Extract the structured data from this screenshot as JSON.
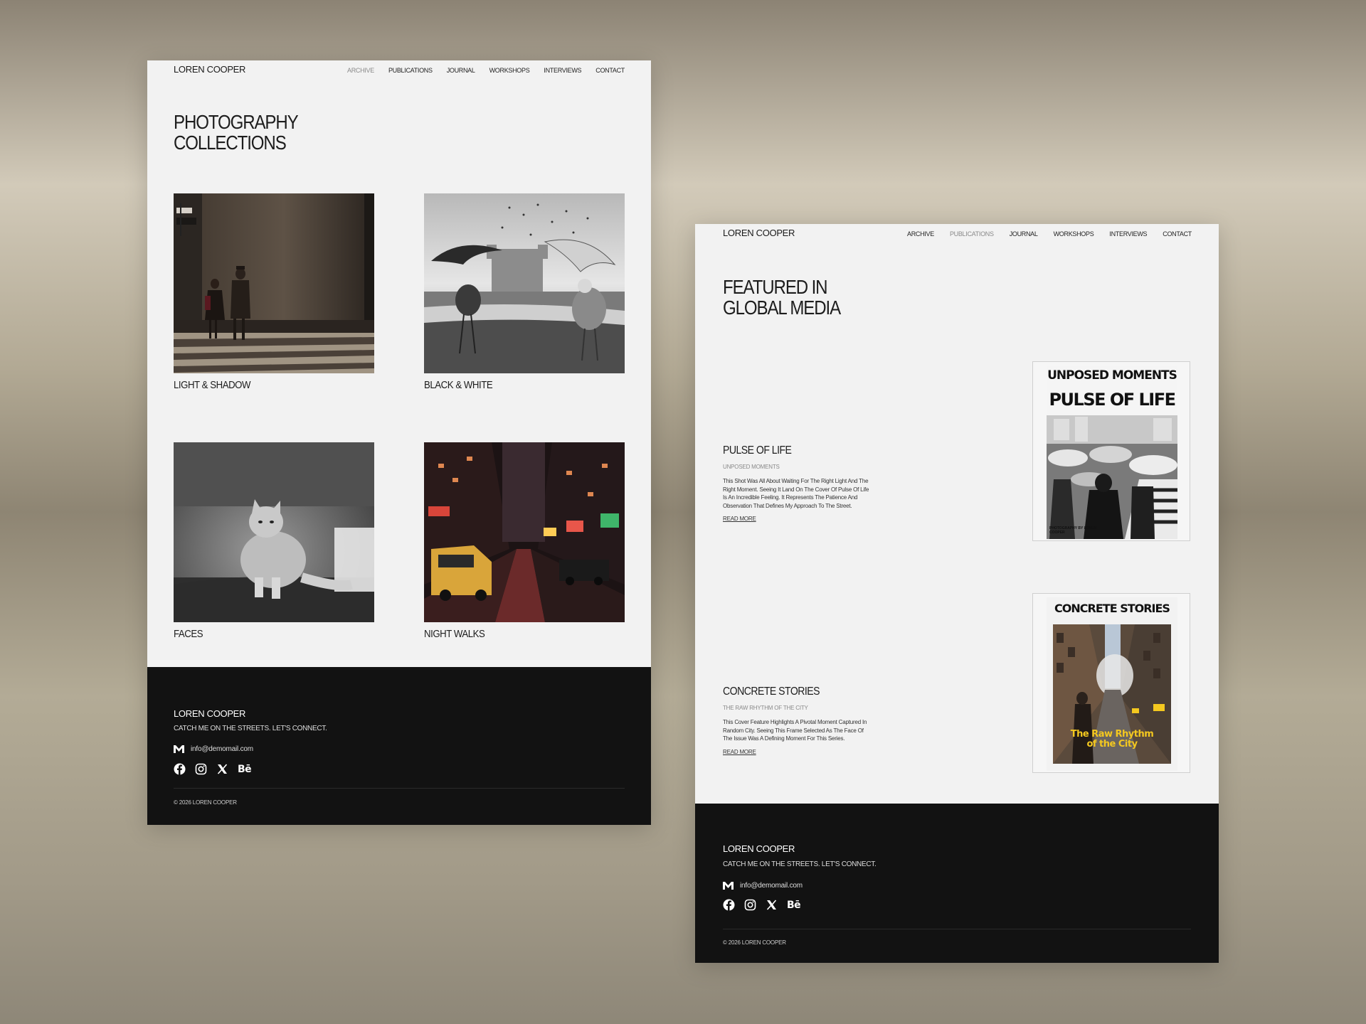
{
  "archive_page": {
    "logo": "LOREN COOPER",
    "nav": [
      {
        "label": "ARCHIVE",
        "active": true
      },
      {
        "label": "PUBLICATIONS",
        "active": false
      },
      {
        "label": "JOURNAL",
        "active": false
      },
      {
        "label": "WORKSHOPS",
        "active": false
      },
      {
        "label": "INTERVIEWS",
        "active": false
      },
      {
        "label": "CONTACT",
        "active": false
      }
    ],
    "heading_line1": "PHOTOGRAPHY",
    "heading_line2": "COLLECTIONS",
    "collections": [
      {
        "label": "LIGHT & SHADOW"
      },
      {
        "label": "BLACK & WHITE"
      },
      {
        "label": "FACES"
      },
      {
        "label": "NIGHT WALKS"
      }
    ],
    "footer": {
      "logo": "LOREN COOPER",
      "tagline": "CATCH ME ON THE STREETS. LET'S CONNECT.",
      "email": "info@demomail.com",
      "social_icons": [
        "facebook-icon",
        "instagram-icon",
        "x-icon",
        "behance-icon"
      ],
      "behance_label": "Bē",
      "copyright": "© 2026 LOREN COOPER"
    }
  },
  "publications_page": {
    "logo": "LOREN COOPER",
    "nav": [
      {
        "label": "ARCHIVE",
        "active": false
      },
      {
        "label": "PUBLICATIONS",
        "active": true
      },
      {
        "label": "JOURNAL",
        "active": false
      },
      {
        "label": "WORKSHOPS",
        "active": false
      },
      {
        "label": "INTERVIEWS",
        "active": false
      },
      {
        "label": "CONTACT",
        "active": false
      }
    ],
    "heading_line1": "FEATURED IN",
    "heading_line2": "GLOBAL MEDIA",
    "features": [
      {
        "title": "PULSE OF LIFE",
        "subtitle": "UNPOSED MOMENTS",
        "description": "This Shot Was All About Waiting For The Right Light And The Right Moment. Seeing It Land On The Cover Of Pulse Of Life Is An Incredible Feeling. It Represents The Patience And Observation That Defines My Approach To The Street.",
        "link": "READ MORE",
        "cover": {
          "masthead": "UNPOSED MOMENTS",
          "headline": "PULSE OF LIFE",
          "credit": "PHOTOGRAPHY BY LOREN COOPER"
        }
      },
      {
        "title": "CONCRETE STORIES",
        "subtitle": "THE RAW RHYTHM OF THE CITY",
        "description": "This Cover Feature Highlights A Pivotal Moment Captured In Random City. Seeing This Frame Selected As The Face Of The Issue Was A Defining Moment For This Series.",
        "link": "READ MORE",
        "cover": {
          "masthead": "CONCRETE STORIES",
          "headline_line1": "The Raw Rhythm",
          "headline_line2": "of the City",
          "headline_color": "#f4c81f"
        }
      }
    ],
    "footer": {
      "logo": "LOREN COOPER",
      "tagline": "CATCH ME ON THE STREETS. LET'S CONNECT.",
      "email": "info@demomail.com",
      "social_icons": [
        "facebook-icon",
        "instagram-icon",
        "x-icon",
        "behance-icon"
      ],
      "behance_label": "Bē",
      "copyright": "© 2026 LOREN COOPER"
    }
  }
}
